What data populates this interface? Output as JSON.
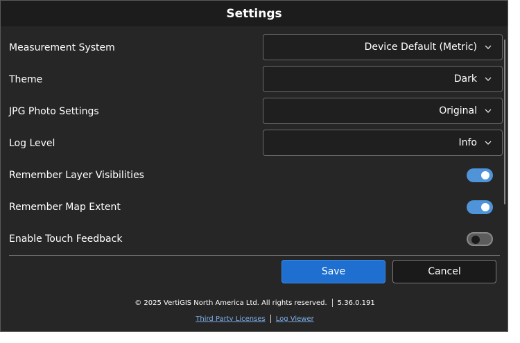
{
  "window": {
    "title": "Settings"
  },
  "settings": {
    "measurement": {
      "label": "Measurement System",
      "value": "Device Default (Metric)"
    },
    "theme": {
      "label": "Theme",
      "value": "Dark"
    },
    "jpg": {
      "label": "JPG Photo Settings",
      "value": "Original"
    },
    "log_level": {
      "label": "Log Level",
      "value": "Info"
    },
    "remember_layers": {
      "label": "Remember Layer Visibilities",
      "on": true
    },
    "remember_extent": {
      "label": "Remember Map Extent",
      "on": true
    },
    "touch_feedback": {
      "label": "Enable Touch Feedback",
      "on": false
    }
  },
  "buttons": {
    "save": "Save",
    "cancel": "Cancel"
  },
  "footer": {
    "copyright": "© 2025 VertiGIS North America Ltd. All rights reserved.",
    "version": "5.36.0.191",
    "third_party": "Third Party Licenses",
    "log_viewer": "Log Viewer"
  },
  "colors": {
    "accent": "#1e6fd0",
    "toggle_on": "#4f93d8",
    "background": "#262626"
  },
  "icons": {
    "dropdown": "chevron-down-icon"
  }
}
